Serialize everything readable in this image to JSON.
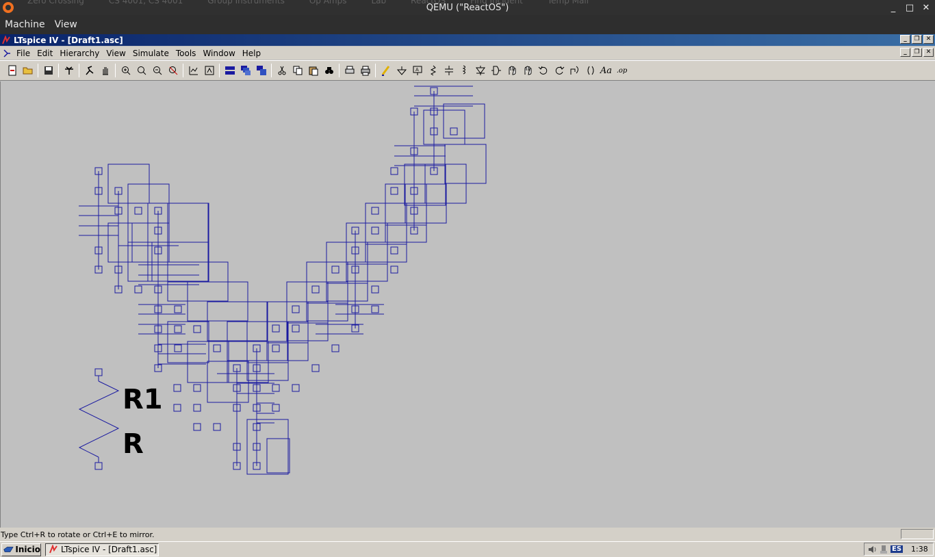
{
  "qemu": {
    "title": "QEMU (\"ReactOS\")",
    "background_tabs": [
      "Zero Crossing",
      "CS 4001, CS 4001",
      "Group Instruments",
      "Op Amps",
      "Lab",
      "ReactOS",
      "Find Incident",
      "Temp Mail"
    ],
    "menu": [
      "Machine",
      "View"
    ],
    "controls": {
      "minimize": "_",
      "maximize": "□",
      "close": "✕"
    }
  },
  "lt": {
    "title": "LTspice IV - [Draft1.asc]",
    "menu": [
      "File",
      "Edit",
      "Hierarchy",
      "View",
      "Simulate",
      "Tools",
      "Window",
      "Help"
    ],
    "toolbar_icons": [
      "new-schematic-icon",
      "open-icon",
      "|",
      "save-icon",
      "|",
      "control-panel-icon",
      "|",
      "run-icon",
      "pan-icon",
      "|",
      "zoom-in-icon",
      "zoom-area-icon",
      "zoom-out-icon",
      "zoom-cancel-icon",
      "|",
      "autorange-icon",
      "fit-icon",
      "|",
      "tile-horizontal-icon",
      "cascade-icon",
      "tile-vertical-icon",
      "|",
      "cut-icon",
      "copy-icon",
      "paste-icon",
      "find-icon",
      "|",
      "print-setup-icon",
      "print-icon",
      "|",
      "wire-icon",
      "ground-icon",
      "label-net-icon",
      "resistor-icon",
      "capacitor-icon",
      "inductor-icon",
      "diode-icon",
      "component-icon",
      "move-icon",
      "drag-icon",
      "undo-icon",
      "redo-icon",
      "rotate-icon",
      "mirror-icon",
      "text-icon",
      "spice-directive-icon"
    ],
    "toolbar_text": {
      "text": "Aa",
      "spice": ".op"
    },
    "resistor": {
      "name": "R1",
      "value": "R"
    },
    "status": "Type Ctrl+R to rotate or Ctrl+E to mirror."
  },
  "taskbar": {
    "start": "Inicio",
    "task": "LTspice IV - [Draft1.asc]",
    "lang": "ES",
    "clock": "1:38"
  },
  "colors": {
    "canvas": "#c0c0c0",
    "wire": "#1a1aa0",
    "titlebar": "#0a246a"
  }
}
